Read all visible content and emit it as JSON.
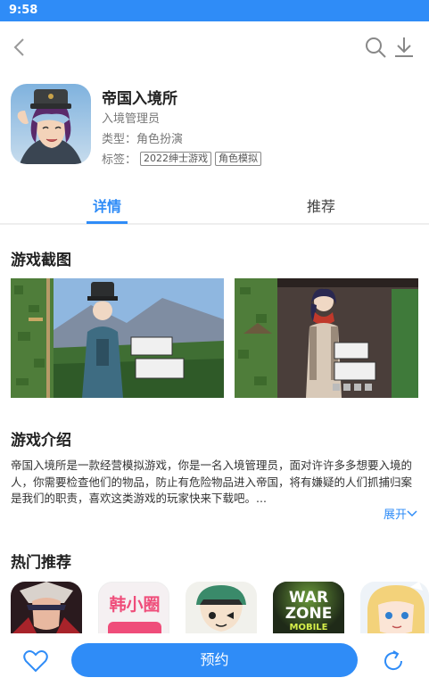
{
  "status_bar": {
    "time": "9:58"
  },
  "top_nav": {
    "back_icon": "chevron-left-icon",
    "search_icon": "search-icon",
    "download_icon": "download-icon"
  },
  "app": {
    "title": "帝国入境所",
    "subtitle": "入境管理员",
    "type_label": "类型：",
    "type_value": "角色扮演",
    "tags_label": "标签：",
    "tags": [
      "2022绅士游戏",
      "角色模拟"
    ]
  },
  "tabs": [
    {
      "label": "详情",
      "active": true
    },
    {
      "label": "推荐",
      "active": false
    }
  ],
  "screenshots": {
    "title": "游戏截图"
  },
  "intro": {
    "title": "游戏介绍",
    "text": "帝国入境所是一款经营模拟游戏，你是一名入境管理员，面对许许多多想要入境的人，你需要检查他们的物品，防止有危险物品进入帝国，将有嫌疑的人们抓捕归案是我们的职责，喜欢这类游戏的玩家快来下载吧。...",
    "expand_label": "展开"
  },
  "hot": {
    "title": "热门推荐",
    "items": [
      "anime-warrior-app-icon",
      "韩小圈",
      "anime-girl-app-icon",
      "WAR ZONE MOBILE",
      "anime-blonde-girl-app-icon"
    ],
    "han_label": "韩小圈",
    "warzone_line1": "WAR",
    "warzone_line2": "ZONE",
    "warzone_line3": "MOBILE"
  },
  "bottom_bar": {
    "reserve_label": "预约",
    "favorite_icon": "heart-icon",
    "refresh_icon": "refresh-icon"
  },
  "colors": {
    "accent": "#2f8cf7"
  }
}
